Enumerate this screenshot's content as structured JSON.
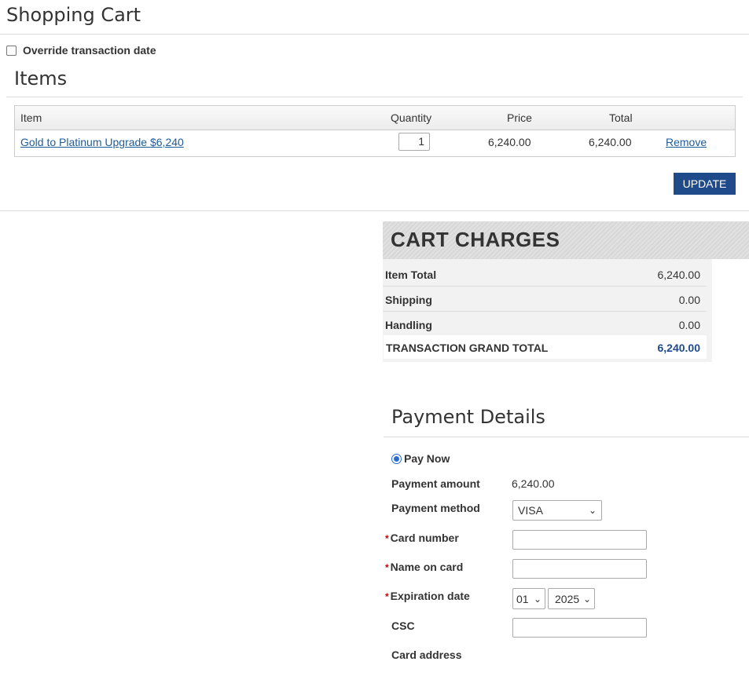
{
  "page": {
    "title": "Shopping Cart"
  },
  "override": {
    "label": "Override transaction date"
  },
  "items": {
    "title": "Items",
    "headers": {
      "item": "Item",
      "quantity": "Quantity",
      "price": "Price",
      "total": "Total"
    },
    "rows": [
      {
        "name": "Gold to Platinum Upgrade $6,240",
        "quantity": "1",
        "price": "6,240.00",
        "total": "6,240.00",
        "remove": "Remove"
      }
    ],
    "update_label": "UPDATE"
  },
  "charges": {
    "title": "CART CHARGES",
    "rows": [
      {
        "label": "Item Total",
        "value": "6,240.00"
      },
      {
        "label": "Shipping",
        "value": "0.00"
      },
      {
        "label": "Handling",
        "value": "0.00"
      }
    ],
    "grand": {
      "label": "TRANSACTION GRAND TOTAL",
      "value": "6,240.00"
    }
  },
  "payment": {
    "title": "Payment Details",
    "pay_now": "Pay Now",
    "amount_label": "Payment amount",
    "amount_value": "6,240.00",
    "method_label": "Payment method",
    "method_value": "VISA",
    "card_number_label": "Card number",
    "name_on_card_label": "Name on card",
    "expiration_label": "Expiration date",
    "exp_month": "01",
    "exp_year": "2025",
    "csc_label": "CSC",
    "card_address_label": "Card address",
    "required_marker": "*"
  },
  "colors": {
    "accent": "#1f4b8a",
    "link": "#1f5c9a",
    "required": "#cc0000"
  }
}
